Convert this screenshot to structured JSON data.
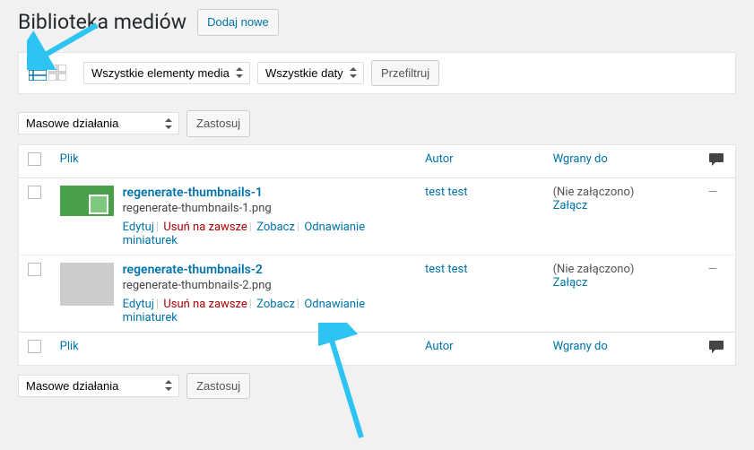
{
  "header": {
    "title": "Biblioteka mediów",
    "add_new_label": "Dodaj nowe"
  },
  "filters": {
    "media_type_select": "Wszystkie elementy media",
    "date_select": "Wszystkie daty",
    "filter_button": "Przefiltruj"
  },
  "bulk": {
    "actions_select": "Masowe działania",
    "apply_label": "Zastosuj"
  },
  "columns": {
    "file": "Plik",
    "author": "Autor",
    "uploaded_to": "Wgrany do"
  },
  "row_actions": {
    "edit": "Edytuj",
    "delete": "Usuń na zawsze",
    "view": "Zobacz",
    "regenerate": "Odnawianie miniaturek"
  },
  "uploaded": {
    "not_attached": "(Nie załączono)",
    "attach": "Załącz"
  },
  "items": [
    {
      "title": "regenerate-thumbnails-1",
      "filename": "regenerate-thumbnails-1.png",
      "author": "test test",
      "comments_dash": "—",
      "thumb_class": "green"
    },
    {
      "title": "regenerate-thumbnails-2",
      "filename": "regenerate-thumbnails-2.png",
      "author": "test test",
      "comments_dash": "—",
      "thumb_class": ""
    }
  ]
}
